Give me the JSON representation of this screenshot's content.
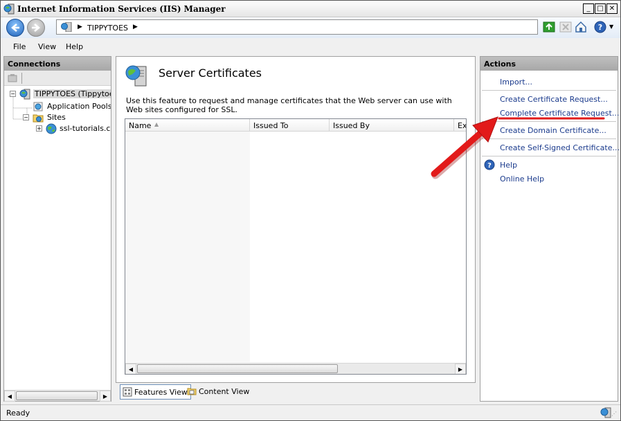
{
  "window": {
    "title": "Internet Information Services (IIS) Manager"
  },
  "address": {
    "crumb": "TIPPYTOES"
  },
  "menu": [
    "File",
    "View",
    "Help"
  ],
  "connections": {
    "header": "Connections",
    "tree": {
      "server": "TIPPYTOES (Tippytoes\\",
      "app_pools": "Application Pools",
      "sites": "Sites",
      "site": "ssl-tutorials.com"
    }
  },
  "feature": {
    "title": "Server Certificates",
    "description": "Use this feature to request and manage certificates that the Web server can use with Web sites configured for SSL.",
    "columns": [
      "Name",
      "Issued To",
      "Issued By",
      "Ex"
    ]
  },
  "view_tabs": {
    "features": "Features View",
    "content": "Content View"
  },
  "actions": {
    "header": "Actions",
    "import": "Import...",
    "create_cert_request": "Create Certificate Request...",
    "complete_cert_request": "Complete Certificate Request...",
    "create_domain_cert": "Create Domain Certificate...",
    "create_self_signed": "Create Self-Signed Certificate...",
    "help": "Help",
    "online_help": "Online Help"
  },
  "status": {
    "text": "Ready"
  },
  "colors": {
    "link": "#1a3a8c",
    "annotation_arrow": "#e21a1a",
    "nav_back": "#1c5fb7"
  }
}
